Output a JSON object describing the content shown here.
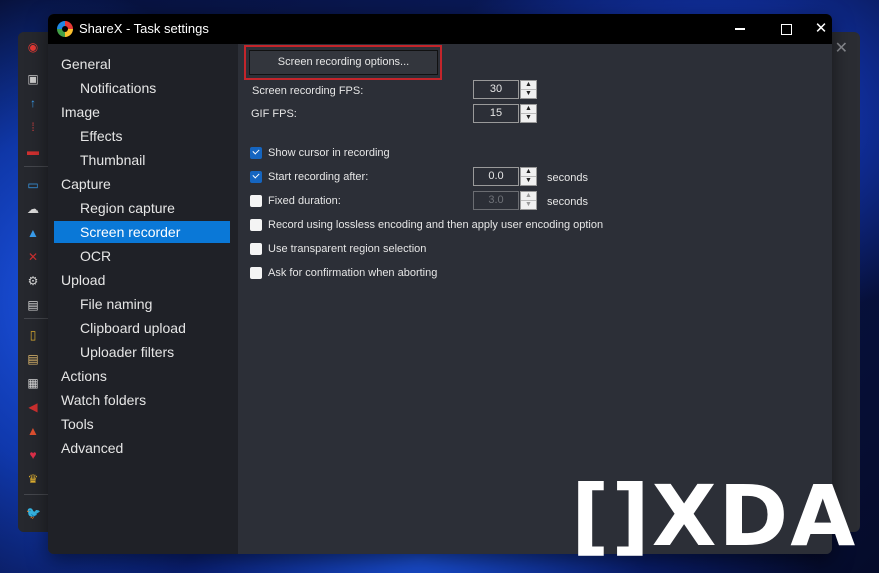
{
  "background_window": {
    "close_glyph": "✕",
    "sidebar_icons": [
      {
        "name": "sharex-logo-icon",
        "glyph": "◉",
        "color": "#e53935"
      },
      {
        "name": "capture-icon",
        "glyph": "▣",
        "color": "#cccccc"
      },
      {
        "name": "upload-icon",
        "glyph": "↑",
        "color": "#3a9ff0"
      },
      {
        "name": "workflows-icon",
        "glyph": "⁞",
        "color": "#c94040"
      },
      {
        "name": "tools-icon",
        "glyph": "▬",
        "color": "#d03030"
      },
      {
        "name": "after-capture-icon",
        "glyph": "▭",
        "color": "#3a9ff0"
      },
      {
        "name": "after-upload-icon",
        "glyph": "☁",
        "color": "#dddddd"
      },
      {
        "name": "destinations-icon",
        "glyph": "▲",
        "color": "#3a9ff0"
      },
      {
        "name": "application-settings-icon",
        "glyph": "✕",
        "color": "#d03030"
      },
      {
        "name": "task-settings-icon",
        "glyph": "⚙",
        "color": "#dddddd"
      },
      {
        "name": "hotkey-settings-icon",
        "glyph": "▤",
        "color": "#dddddd"
      },
      {
        "name": "screenshots-folder-icon",
        "glyph": "▯",
        "color": "#e0b030"
      },
      {
        "name": "history-icon",
        "glyph": "▤",
        "color": "#e8c070"
      },
      {
        "name": "image-history-icon",
        "glyph": "▦",
        "color": "#dddddd"
      },
      {
        "name": "news-icon",
        "glyph": "◀",
        "color": "#d03030"
      },
      {
        "name": "debug-icon",
        "glyph": "▲",
        "color": "#e05030"
      },
      {
        "name": "donate-icon",
        "glyph": "♥",
        "color": "#e0304a"
      },
      {
        "name": "about-icon",
        "glyph": "♛",
        "color": "#e0b030"
      },
      {
        "name": "twitter-icon",
        "glyph": "🐦",
        "color": "#1da1f2"
      }
    ]
  },
  "dialog": {
    "title": "ShareX - Task settings",
    "controls": {
      "minimize": "minimize",
      "maximize": "maximize",
      "close": "✕"
    }
  },
  "nav": {
    "items": [
      {
        "label": "General",
        "level": 0,
        "selected": false
      },
      {
        "label": "Notifications",
        "level": 1,
        "selected": false
      },
      {
        "label": "Image",
        "level": 0,
        "selected": false
      },
      {
        "label": "Effects",
        "level": 1,
        "selected": false
      },
      {
        "label": "Thumbnail",
        "level": 1,
        "selected": false
      },
      {
        "label": "Capture",
        "level": 0,
        "selected": false
      },
      {
        "label": "Region capture",
        "level": 1,
        "selected": false
      },
      {
        "label": "Screen recorder",
        "level": 1,
        "selected": true
      },
      {
        "label": "OCR",
        "level": 1,
        "selected": false
      },
      {
        "label": "Upload",
        "level": 0,
        "selected": false
      },
      {
        "label": "File naming",
        "level": 1,
        "selected": false
      },
      {
        "label": "Clipboard upload",
        "level": 1,
        "selected": false
      },
      {
        "label": "Uploader filters",
        "level": 1,
        "selected": false
      },
      {
        "label": "Actions",
        "level": 0,
        "selected": false
      },
      {
        "label": "Watch folders",
        "level": 0,
        "selected": false
      },
      {
        "label": "Tools",
        "level": 0,
        "selected": false
      },
      {
        "label": "Advanced",
        "level": 0,
        "selected": false
      }
    ]
  },
  "content": {
    "options_button": "Screen recording options...",
    "highlight_color": "#c3252b",
    "fps": {
      "label": "Screen recording FPS:",
      "value": "30"
    },
    "gif_fps": {
      "label": "GIF FPS:",
      "value": "15"
    },
    "show_cursor": {
      "label": "Show cursor in recording",
      "checked": true
    },
    "start_after": {
      "label": "Start recording after:",
      "checked": true,
      "value": "0.0",
      "unit": "seconds"
    },
    "fixed_duration": {
      "label": "Fixed duration:",
      "checked": false,
      "value": "3.0",
      "unit": "seconds",
      "disabled": true
    },
    "lossless": {
      "label": "Record using lossless encoding and then apply user encoding option",
      "checked": false
    },
    "transparent": {
      "label": "Use transparent region selection",
      "checked": false
    },
    "confirm_abort": {
      "label": "Ask for confirmation when aborting",
      "checked": false
    },
    "spin_up": "▲",
    "spin_down": "▼"
  },
  "watermark": {
    "text": "[]XDA"
  },
  "colors": {
    "accent": "#0a78d7",
    "checkbox_checked": "#1565c0",
    "titlebar": "#000000"
  }
}
